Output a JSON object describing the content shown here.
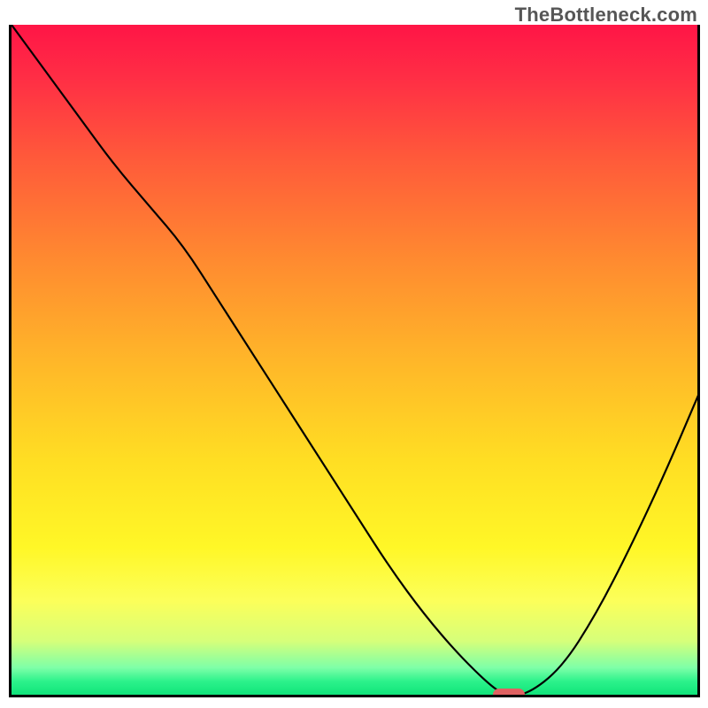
{
  "watermark": "TheBottleneck.com",
  "colors": {
    "marker": "#e06262",
    "border": "#000000"
  },
  "chart_data": {
    "type": "line",
    "title": "",
    "xlabel": "",
    "ylabel": "",
    "xlim": [
      0,
      100
    ],
    "ylim": [
      0,
      100
    ],
    "grid": false,
    "curve_note": "V-shaped bottleneck curve; values are approximate readings from gradient position (y = 0 at top of plot, 100 at bottom)",
    "x": [
      0,
      5,
      10,
      15,
      20,
      25,
      30,
      35,
      40,
      45,
      50,
      55,
      60,
      65,
      70,
      72,
      75,
      80,
      85,
      90,
      95,
      100
    ],
    "y_top": [
      0,
      7,
      14,
      21,
      27,
      33,
      41,
      49,
      57,
      65,
      73,
      81,
      88,
      94,
      99,
      100,
      100,
      96,
      88,
      78,
      67,
      55
    ],
    "minimum_x": 72,
    "marker": {
      "x": 72,
      "y": 100
    }
  }
}
